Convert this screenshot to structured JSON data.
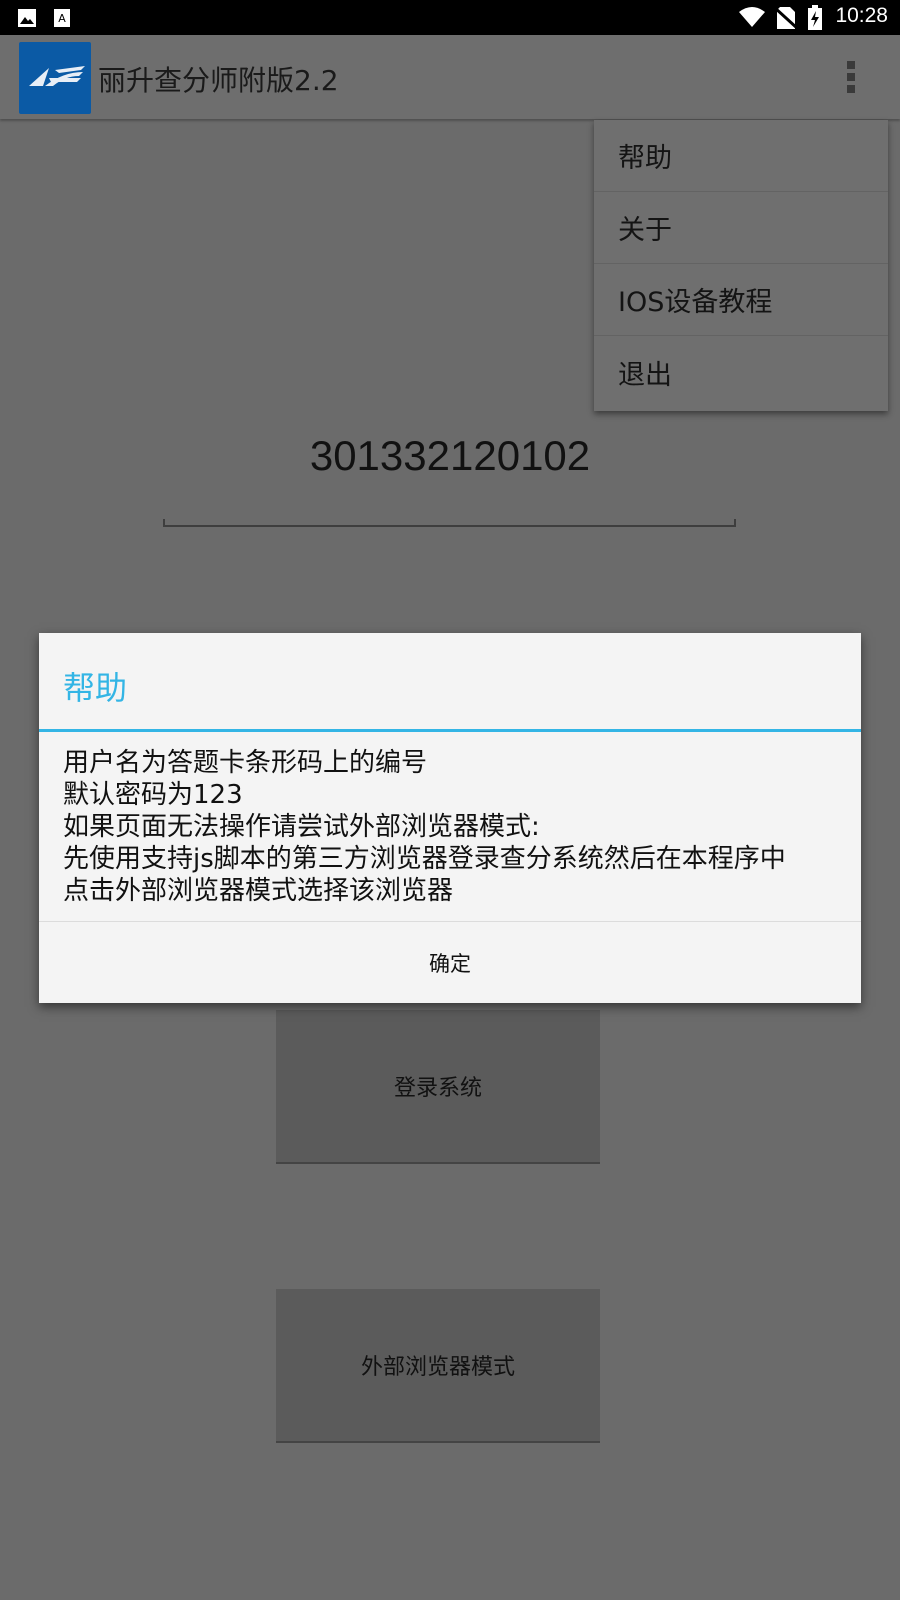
{
  "status_bar": {
    "time": "10:28",
    "icons": [
      "image-icon",
      "keyboard-icon",
      "wifi-icon",
      "no-sim-icon",
      "battery-charging-icon"
    ]
  },
  "action_bar": {
    "title": "丽升查分师附版2.2",
    "logo": "ls-logo",
    "overflow_icon": "more-vert-icon"
  },
  "main": {
    "id_value": "301332120102",
    "login_button": "登录系统",
    "external_browser_button": "外部浏览器模式"
  },
  "menu": {
    "items": [
      {
        "label": "帮助"
      },
      {
        "label": "关于"
      },
      {
        "label": "IOS设备教程"
      },
      {
        "label": "退出"
      }
    ]
  },
  "dialog": {
    "title": "帮助",
    "lines": [
      "用户名为答题卡条形码上的编号",
      "默认密码为123",
      "如果页面无法操作请尝试外部浏览器模式:",
      "先使用支持js脚本的第三方浏览器登录查分系统然后在本程序中",
      "点击外部浏览器模式选择该浏览器"
    ],
    "ok_button": "确定"
  },
  "colors": {
    "accent": "#33b5e5",
    "logo_bg": "#0b5aa5",
    "dim_background": "#6b6b6b"
  }
}
